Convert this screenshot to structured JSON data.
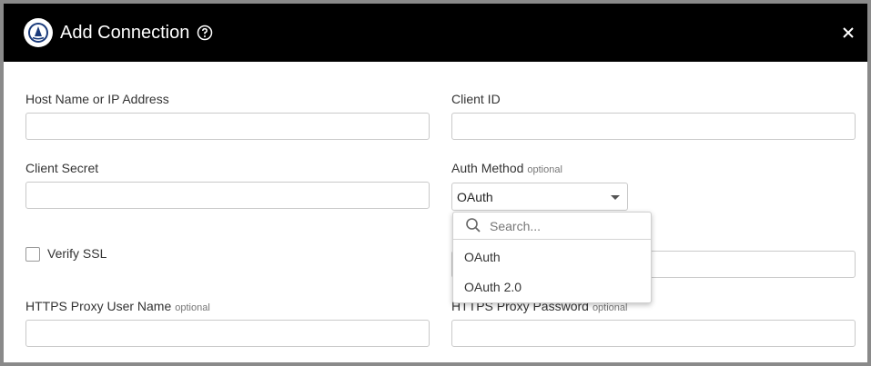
{
  "dialog": {
    "title": "Add Connection",
    "header_bg": "#000000",
    "logo_color": "#1a3a7a"
  },
  "form": {
    "host": {
      "label": "Host Name or IP Address",
      "value": ""
    },
    "client_id": {
      "label": "Client ID",
      "value": ""
    },
    "client_secret": {
      "label": "Client Secret",
      "value": ""
    },
    "auth_method": {
      "label": "Auth Method",
      "optional": "optional",
      "value": "OAuth"
    },
    "verify_ssl": {
      "label": "Verify SSL",
      "checked": false
    },
    "proxy_user": {
      "label": "HTTPS Proxy User Name",
      "optional": "optional",
      "value": ""
    },
    "proxy_password": {
      "label": "HTTPS Proxy Password",
      "optional": "optional",
      "value": ""
    }
  },
  "dropdown": {
    "search_placeholder": "Search...",
    "options": [
      "OAuth",
      "OAuth 2.0"
    ]
  },
  "icons": {
    "logo": "sailboat-logo-icon",
    "help": "question-circle-icon",
    "close": "close-icon",
    "caret": "caret-down-icon",
    "search": "search-icon"
  }
}
